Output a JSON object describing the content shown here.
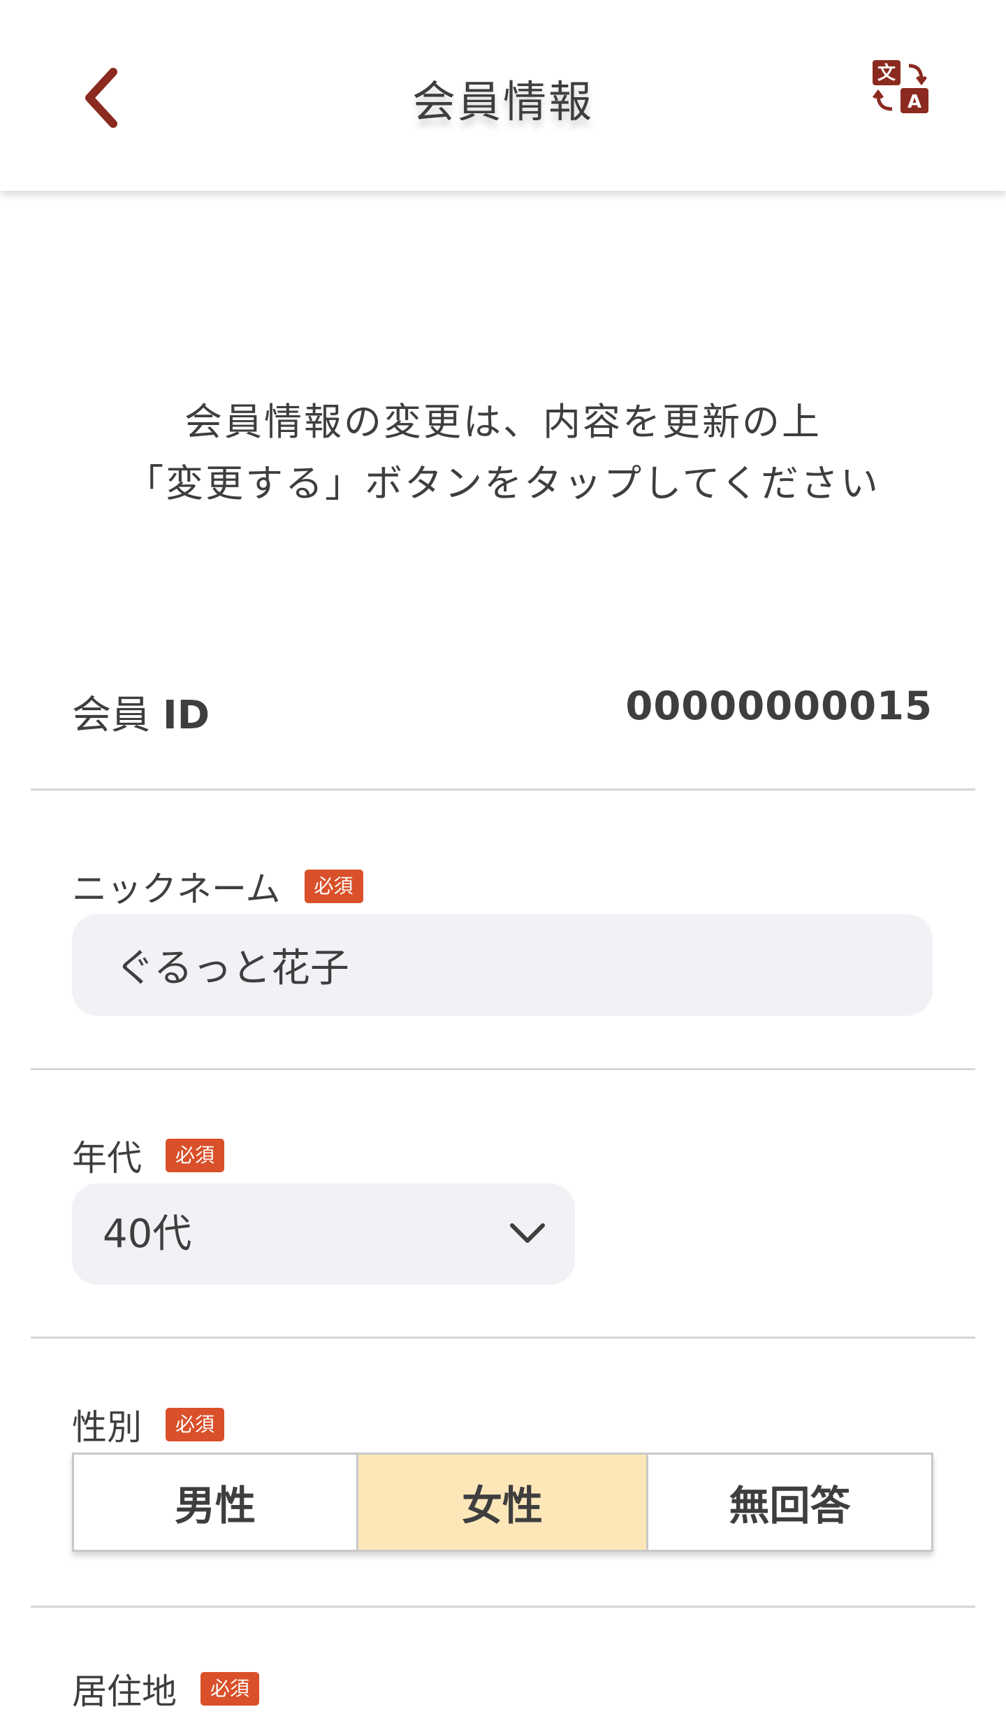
{
  "header": {
    "title": "会員情報",
    "back_icon": "chevron-left-icon",
    "translate_icon": "translate-icon"
  },
  "instruction": {
    "line1": "会員情報の変更は、内容を更新の上",
    "line2": "「変更する」ボタンをタップしてください"
  },
  "member_id": {
    "label_prefix": "会員",
    "label_suffix": "ID",
    "value": "00000000015"
  },
  "nickname": {
    "label": "ニックネーム",
    "required": "必須",
    "value": "ぐるっと花子"
  },
  "age": {
    "label": "年代",
    "required": "必須",
    "selected": "40代"
  },
  "gender": {
    "label": "性別",
    "required": "必須",
    "options": [
      "男性",
      "女性",
      "無回答"
    ],
    "selected_index": 1
  },
  "residence": {
    "label": "居住地",
    "required": "必須"
  },
  "colors": {
    "accent": "#8b2a1f",
    "required_badge": "#d9502a",
    "selected_segment": "#fde7b9",
    "input_bg": "#f0f2f5"
  }
}
